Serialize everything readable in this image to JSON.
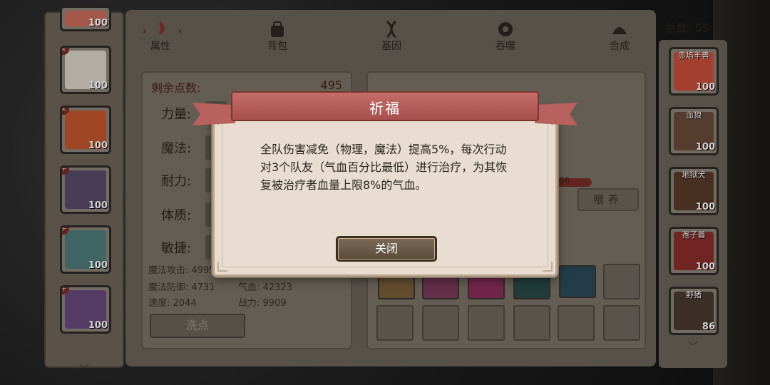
{
  "tabs": [
    {
      "label": "属性",
      "icon": "flame-icon"
    },
    {
      "label": "背包",
      "icon": "bag-icon"
    },
    {
      "label": "基因",
      "icon": "dna-icon"
    },
    {
      "label": "吞噬",
      "icon": "devour-icon"
    },
    {
      "label": "合成",
      "icon": "merge-icon"
    }
  ],
  "total": {
    "label": "总数: 55"
  },
  "stats": {
    "remaining_label": "剩余点数:",
    "remaining_value": "495",
    "labels": [
      "力量:",
      "魔法:",
      "耐力:",
      "体质:",
      "敏捷:"
    ],
    "magic_attack": "魔法攻击: 4995",
    "magic_defense": "魔法防御: 4731",
    "hp": "气血: 42323",
    "speed": "速度: 2044",
    "power": "战力: 9909",
    "wash_button": "洗点"
  },
  "heroes": [
    {
      "level": "100",
      "color": "#c96a5a"
    },
    {
      "level": "100",
      "color": "#d9d2c8"
    },
    {
      "level": "100",
      "color": "#c2562d"
    },
    {
      "level": "100",
      "color": "#5a4a6a"
    },
    {
      "level": "100",
      "color": "#4f7a7a"
    },
    {
      "level": "100",
      "color": "#6a4a7a"
    }
  ],
  "pets": [
    {
      "name": "赤焰羊兽",
      "level": "100",
      "color": "#c94f3a"
    },
    {
      "name": "血狼",
      "level": "100",
      "color": "#6a4a3a"
    },
    {
      "name": "地狱犬",
      "level": "100",
      "color": "#5a3a2a"
    },
    {
      "name": "孢子兽",
      "level": "100",
      "color": "#8a2e2a"
    },
    {
      "name": "野猪",
      "level": "86",
      "color": "#4a3a30"
    }
  ],
  "right_panel": {
    "level_badge": "86",
    "feed_button": "喂养"
  },
  "modal": {
    "title": "祈福",
    "body": "全队伤害减免（物理，魔法）提高5%，每次行动对3个队友（气血百分比最低）进行治疗，为其恢复被治疗者血量上限8%的气血。",
    "close_button": "关闭"
  }
}
